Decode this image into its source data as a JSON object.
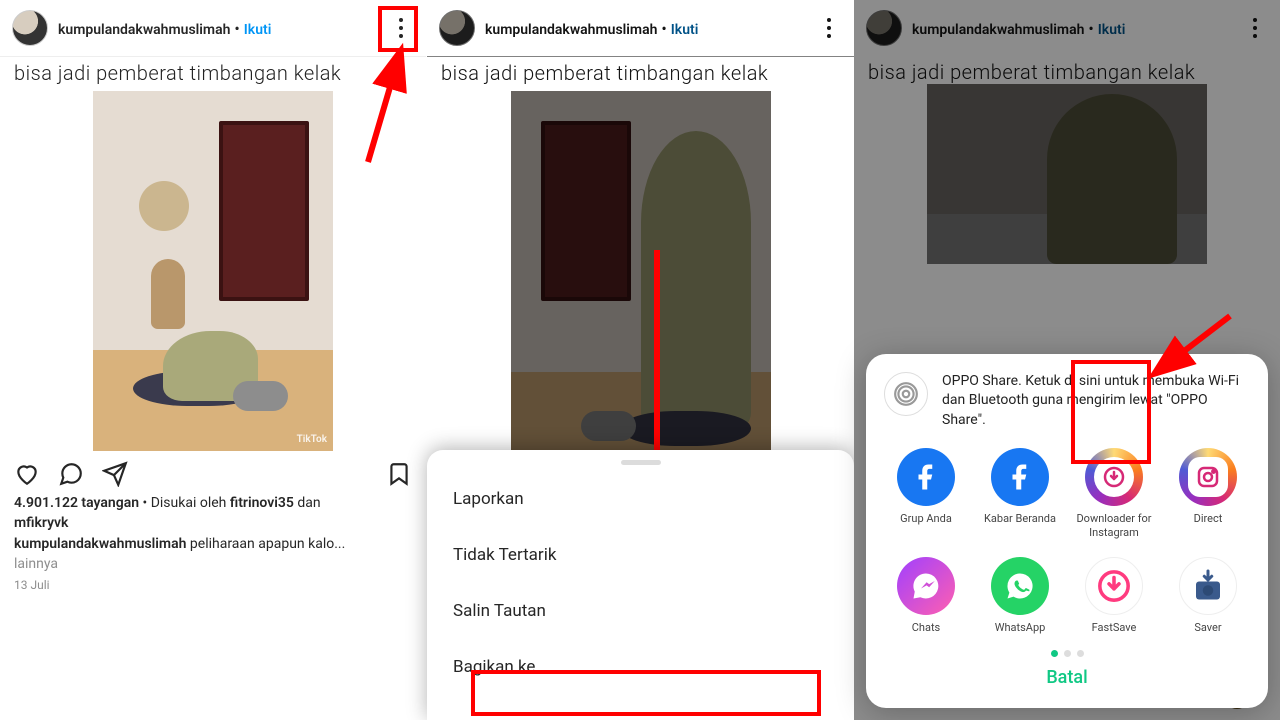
{
  "post": {
    "username": "kumpulandakwahmuslimah",
    "follow": "Ikuti",
    "sep": " • ",
    "caption": "bisa jadi pemberat timbangan kelak",
    "watermark": "TikTok"
  },
  "likes": {
    "views": "4.901.122 tayangan",
    "liked_by_prefix": " • Disukai oleh ",
    "user1": "fitrinovi35",
    "and": " dan ",
    "user2": "mfikryvk",
    "caption_user": "kumpulandakwahmuslimah",
    "caption_text": " peliharaan apapun kalo... ",
    "more": "lainnya",
    "date": "13 Juli"
  },
  "menu": {
    "report": "Laporkan",
    "notint": "Tidak Tertarik",
    "copy": "Salin Tautan",
    "share": "Bagikan ke..."
  },
  "share": {
    "oppo": "OPPO Share. Ketuk di sini untuk membuka Wi-Fi dan Bluetooth guna mengirim lewat \"OPPO Share\".",
    "items": {
      "fb_group": "Grup Anda",
      "fb_feed": "Kabar Beranda",
      "dlig": "Downloader for Instagram",
      "direct": "Direct",
      "chats": "Chats",
      "wa": "WhatsApp",
      "fastsave": "FastSave",
      "saver": "Saver"
    },
    "cancel": "Batal"
  }
}
